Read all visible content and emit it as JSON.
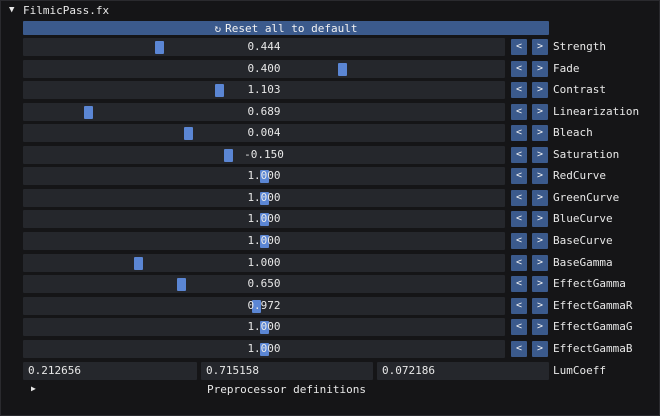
{
  "header": {
    "arrow_glyph": "▼",
    "title": "FilmicPass.fx"
  },
  "reset": {
    "icon": "undo-icon",
    "icon_glyph": "↻",
    "label": "Reset all to default"
  },
  "buttons": {
    "dec": "<",
    "inc": ">"
  },
  "params": [
    {
      "label": "Strength",
      "value": "0.444",
      "level": 0.28
    },
    {
      "label": "Fade",
      "value": "0.400",
      "level": 0.665
    },
    {
      "label": "Contrast",
      "value": "1.103",
      "level": 0.405
    },
    {
      "label": "Linearization",
      "value": "0.689",
      "level": 0.13
    },
    {
      "label": "Bleach",
      "value": "0.004",
      "level": 0.34
    },
    {
      "label": "Saturation",
      "value": "-0.150",
      "level": 0.425
    },
    {
      "label": "RedCurve",
      "value": "1.000",
      "level": 0.5
    },
    {
      "label": "GreenCurve",
      "value": "1.000",
      "level": 0.5
    },
    {
      "label": "BlueCurve",
      "value": "1.000",
      "level": 0.5
    },
    {
      "label": "BaseCurve",
      "value": "1.000",
      "level": 0.5
    },
    {
      "label": "BaseGamma",
      "value": "1.000",
      "level": 0.235
    },
    {
      "label": "EffectGamma",
      "value": "0.650",
      "level": 0.325
    },
    {
      "label": "EffectGammaR",
      "value": "0.972",
      "level": 0.485
    },
    {
      "label": "EffectGammaG",
      "value": "1.000",
      "level": 0.5
    },
    {
      "label": "EffectGammaB",
      "value": "1.000",
      "level": 0.5
    }
  ],
  "lumcoeff": {
    "label": "LumCoeff",
    "values": [
      "0.212656",
      "0.715158",
      "0.072186"
    ]
  },
  "preprocessor": {
    "arrow_glyph": "▶",
    "label": "Preprocessor definitions"
  },
  "colors": {
    "accent": "#3b5a8c",
    "grab": "#5b86d4",
    "frame": "#25272c"
  }
}
